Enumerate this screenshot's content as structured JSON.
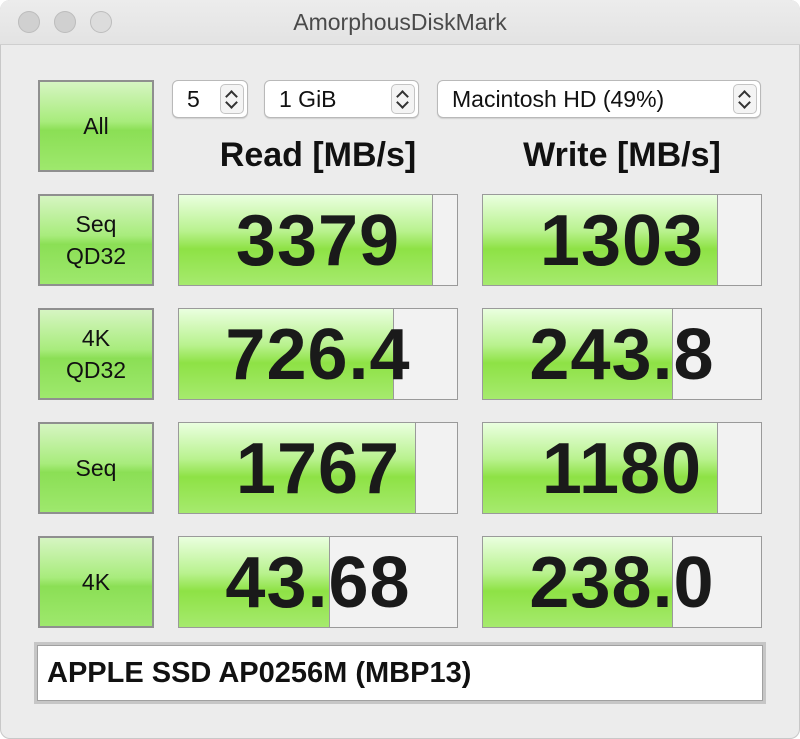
{
  "window": {
    "title": "AmorphousDiskMark"
  },
  "controls": {
    "count": "5",
    "size": "1 GiB",
    "target": "Macintosh HD (49%)"
  },
  "headers": {
    "read": "Read [MB/s]",
    "write": "Write [MB/s]"
  },
  "buttons": {
    "all": "All",
    "rows": [
      {
        "line1": "Seq",
        "line2": "QD32"
      },
      {
        "line1": "4K",
        "line2": "QD32"
      },
      {
        "line1": "Seq",
        "line2": ""
      },
      {
        "line1": "4K",
        "line2": ""
      }
    ]
  },
  "results": [
    {
      "read": "3379",
      "read_fraction": 0.91,
      "write": "1303",
      "write_fraction": 0.84
    },
    {
      "read": "726.4",
      "read_fraction": 0.77,
      "write": "243.8",
      "write_fraction": 0.68
    },
    {
      "read": "1767",
      "read_fraction": 0.85,
      "write": "1180",
      "write_fraction": 0.84
    },
    {
      "read": "43.68",
      "read_fraction": 0.54,
      "write": "238.0",
      "write_fraction": 0.68
    }
  ],
  "device": {
    "name": "APPLE SSD AP0256M (MBP13)"
  },
  "colors": {
    "accent_green": "#8ee245"
  }
}
